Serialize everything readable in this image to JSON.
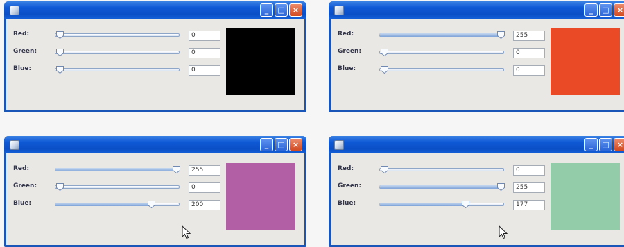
{
  "labels": {
    "red": "Red:",
    "green": "Green:",
    "blue": "Blue:"
  },
  "title_buttons": {
    "minimize": "_",
    "maximize": "□",
    "close": "×"
  },
  "windows": [
    {
      "id": "w1",
      "red": 0,
      "green": 0,
      "blue": 0,
      "red_text": "0",
      "green_text": "0",
      "blue_text": "0",
      "swatch": "#000000"
    },
    {
      "id": "w2",
      "red": 255,
      "green": 0,
      "blue": 0,
      "red_text": "255",
      "green_text": "0",
      "blue_text": "0",
      "swatch": "#ea4a26"
    },
    {
      "id": "w3",
      "red": 255,
      "green": 0,
      "blue": 200,
      "red_text": "255",
      "green_text": "0",
      "blue_text": "200",
      "swatch": "#b25fa6"
    },
    {
      "id": "w4",
      "red": 0,
      "green": 255,
      "blue": 177,
      "red_text": "0",
      "green_text": "255",
      "blue_text": "177",
      "swatch": "#93cca8"
    }
  ],
  "colors": {
    "title_bar": "#0b4fc6",
    "window_body": "#e9e8e4",
    "close_button": "#d14a22"
  }
}
